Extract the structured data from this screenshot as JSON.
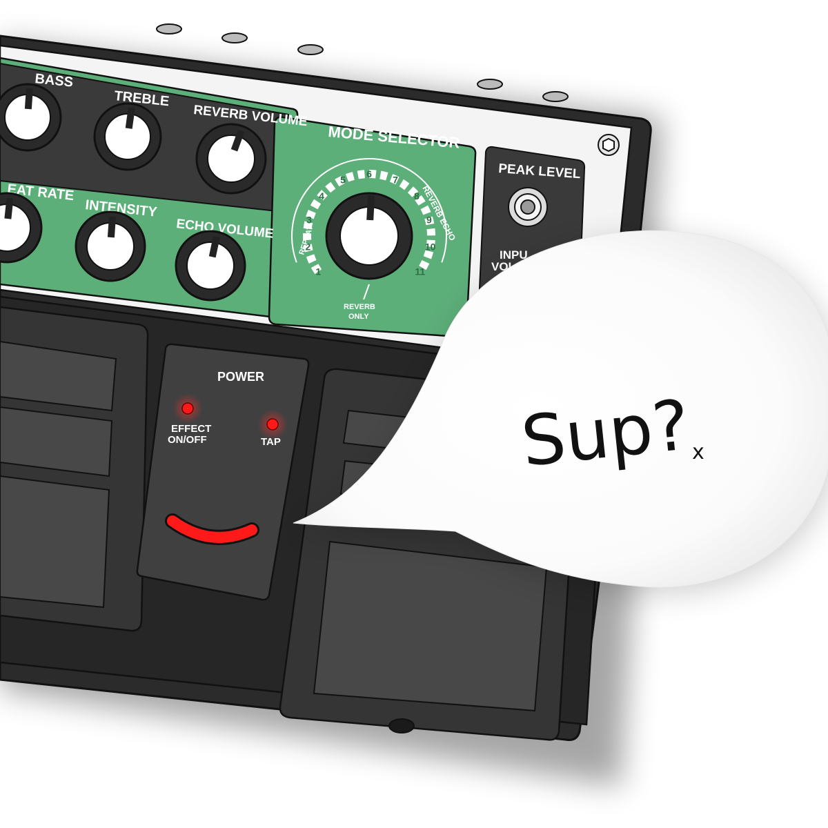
{
  "panel": {
    "controls_top": {
      "bass_label": "BASS",
      "treble_label": "TREBLE",
      "reverb_volume_label": "REVERB VOLUME"
    },
    "controls_bottom": {
      "repeat_rate_label": "EAT RATE",
      "intensity_label": "INTENSITY",
      "echo_volume_label": "ECHO VOLUME"
    },
    "mode_selector": {
      "title": "MODE SELECTOR",
      "numbers": [
        "1",
        "2",
        "3",
        "4",
        "5",
        "6",
        "7",
        "8",
        "9",
        "10",
        "11"
      ],
      "repeat_label": "REPEAT",
      "reverb_echo_label": "REVERB ECHO",
      "reverb_only_line1": "REVERB",
      "reverb_only_line2": "ONLY"
    },
    "peak": {
      "title": "PEAK LEVEL",
      "input_line1": "INPU",
      "input_line2": "VOL"
    }
  },
  "pedal": {
    "power_label": "POWER",
    "effect_line1": "EFFECT",
    "effect_line2": "ON/OFF",
    "tap_label": "TAP"
  },
  "speech": {
    "text": "Sup?",
    "kiss": "x"
  },
  "colors": {
    "panel_green": "#5daf7a",
    "panel_dark": "#3a3a3a",
    "led_red": "#ff1a1a",
    "pedal_dark": "#2a2a2a",
    "speech_fill": "#ffffff"
  }
}
